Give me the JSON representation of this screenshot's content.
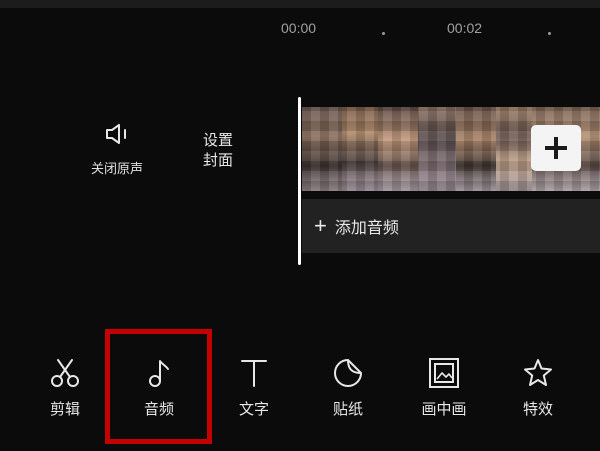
{
  "timeline": {
    "times": [
      "00:00",
      "00:02"
    ]
  },
  "left_controls": {
    "mute_label": "关闭原声",
    "cover_line1": "设置",
    "cover_line2": "封面"
  },
  "track": {
    "add_clip_symbol": "+",
    "add_audio_symbol": "+",
    "add_audio_label": "添加音频"
  },
  "toolbar": {
    "items": [
      {
        "label": "剪辑",
        "icon": "scissors-icon"
      },
      {
        "label": "音频",
        "icon": "music-note-icon"
      },
      {
        "label": "文字",
        "icon": "text-icon"
      },
      {
        "label": "贴纸",
        "icon": "sticker-icon"
      },
      {
        "label": "画中画",
        "icon": "picture-in-picture-icon"
      },
      {
        "label": "特效",
        "icon": "star-effects-icon"
      }
    ]
  },
  "colors": {
    "background": "#0b0b0b",
    "highlight": "#c40000",
    "audio_track": "#222222"
  }
}
